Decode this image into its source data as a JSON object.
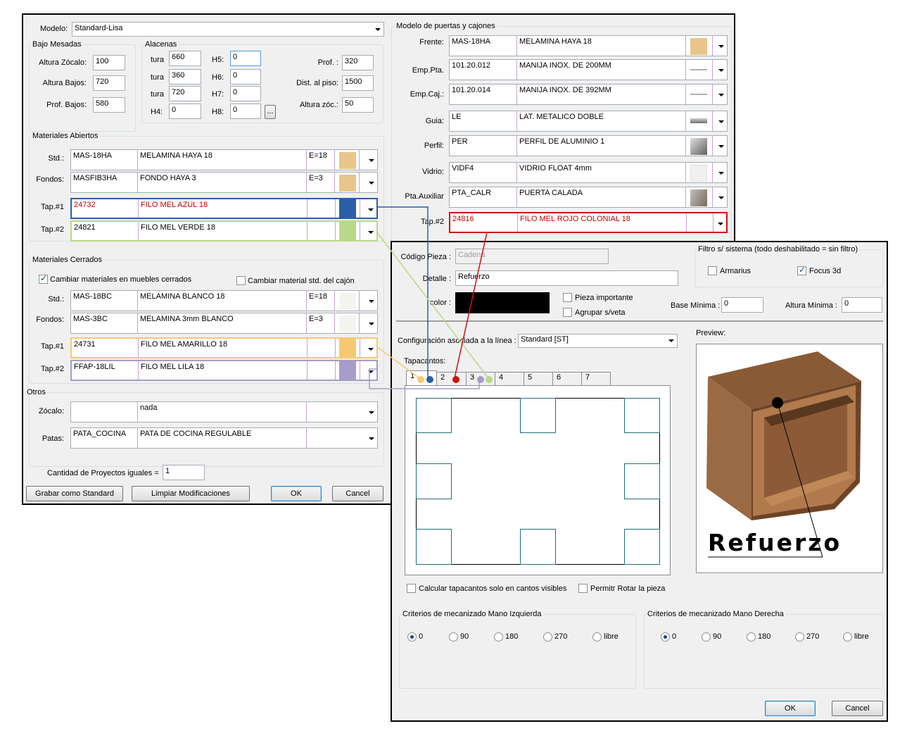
{
  "colors": {
    "blue": "#2a5fa8",
    "green": "#b8d98a",
    "red": "#d01010",
    "yellow": "#f8c870",
    "lila": "#a89cc8",
    "wood": "#e8c68a",
    "white": "#f5f5f0"
  },
  "main": {
    "modelo_label": "Modelo:",
    "modelo_value": "Standard-Lisa",
    "bajo_mesadas": {
      "title": "Bajo Mesadas",
      "altura_zocalo_label": "Altura Zócalo:",
      "altura_zocalo": "100",
      "altura_bajos_label": "Altura Bajos:",
      "altura_bajos": "720",
      "prof_bajos_label": "Prof. Bajos:",
      "prof_bajos": "580"
    },
    "alacenas": {
      "title": "Alacenas",
      "tura1_label": "tura",
      "tura1": "660",
      "tura2_label": "tura",
      "tura2": "360",
      "tura3_label": "tura",
      "tura3": "720",
      "h4_label": "H4:",
      "h4": "0",
      "h5_label": "H5:",
      "h5": "0",
      "h6_label": "H6:",
      "h6": "0",
      "h7_label": "H7:",
      "h7": "0",
      "h8_label": "H8:",
      "h8": "0",
      "more_label": "...",
      "prof_label": "Prof. :",
      "prof": "320",
      "dist_label": "Dist. al piso:",
      "dist": "1500",
      "alt_zoc_label": "Altura zóc.:",
      "alt_zoc": "50"
    },
    "abiertos": {
      "title": "Materiales Abiertos",
      "rows": [
        {
          "label": "Std.:",
          "code": "MAS-18HA",
          "desc": "MELAMINA HAYA 18",
          "e": "E=18"
        },
        {
          "label": "Fondos:",
          "code": "MASFIB3HA",
          "desc": "FONDO HAYA 3",
          "e": "E=3"
        },
        {
          "label": "Tap.#1",
          "code": "24732",
          "desc": "FILO MEL AZUL 18",
          "e": ""
        },
        {
          "label": "Tap.#2",
          "code": "24821",
          "desc": "FILO MEL VERDE 18",
          "e": ""
        }
      ]
    },
    "cerrados": {
      "title": "Materiales Cerrados",
      "chk1": "Cambiar materiales en muebles cerrados",
      "chk2": "Cambiar material std. del cajón",
      "rows": [
        {
          "label": "Std.:",
          "code": "MAS-18BC",
          "desc": "MELAMINA BLANCO 18",
          "e": "E=18"
        },
        {
          "label": "Fondos:",
          "code": "MAS-3BC",
          "desc": "MELAMINA 3mm BLANCO",
          "e": "E=3"
        },
        {
          "label": "Tap.#1",
          "code": "24731",
          "desc": "FILO MEL AMARILLO 18",
          "e": ""
        },
        {
          "label": "Tap.#2",
          "code": "FFAP-18LIL",
          "desc": "FILO MEL LILA 18",
          "e": ""
        }
      ]
    },
    "otros": {
      "title": "Otros",
      "rows": [
        {
          "label": "Zócalo:",
          "code": "",
          "desc": "nada"
        },
        {
          "label": "Patas:",
          "code": "PATA_COCINA",
          "desc": "PATA DE COCINA REGULABLE"
        }
      ]
    },
    "cantidad_label": "Cantidad de Proyectos iguales =",
    "cantidad": "1",
    "btn_grabar": "Grabar como Standard",
    "btn_limpiar": "Limpiar Modificaciones",
    "btn_ok": "OK",
    "btn_cancel": "Cancel",
    "puertas": {
      "title": "Modelo de puertas y cajones",
      "rows": [
        {
          "label": "Frente:",
          "code": "MAS-18HA",
          "desc": "MELAMINA HAYA 18"
        },
        {
          "label": "Emp.Pta.",
          "code": "101.20.012",
          "desc": "MANIJA INOX. DE 200MM"
        },
        {
          "label": "Emp.Caj.:",
          "code": "101.20.014",
          "desc": "MANIJA INOX. DE 392MM"
        },
        {
          "label": "Guia:",
          "code": "LE",
          "desc": "LAT. METALICO DOBLE"
        },
        {
          "label": "Perfil:",
          "code": "PER",
          "desc": "PERFIL DE ALUMINIO 1"
        },
        {
          "label": "Vidrio:",
          "code": "VIDF4",
          "desc": "VIDRIO FLOAT 4mm"
        },
        {
          "label": "Pta.Auxiliar",
          "code": "PTA_CALR",
          "desc": "PUERTA CALADA"
        },
        {
          "label": "Tap.#2",
          "code": "24816",
          "desc": "FILO MEL ROJO COLONIAL 18"
        }
      ]
    }
  },
  "piece": {
    "codigo_label": "Código Pieza :",
    "codigo": "Cadena",
    "detalle_label": "Detalle :",
    "detalle": "Refuerzo",
    "color_label": "color :",
    "pieza_importante": "Pieza importante",
    "agrupar": "Agrupar s/veta",
    "filtro_title": "Filtro s/ sistema (todo deshabilitado = sin filtro)",
    "armarius": "Armarius",
    "focus": "Focus 3d",
    "base_min_label": "Base Mínima :",
    "base_min": "0",
    "altura_min_label": "Altura Mínima :",
    "altura_min": "0",
    "config_label": "Configuración asociada a la línea :",
    "config_value": "Standard [ST]",
    "tapacantos_label": "Tapacantos:",
    "tabs": [
      "1",
      "2",
      "3",
      "4",
      "5",
      "6",
      "7"
    ],
    "preview_label": "Preview:",
    "preview_text": "Refuerzo",
    "calc_visible": "Calcular tapacantos solo en cantos visibles",
    "permitir_rotar": "Permitr Rotar la pieza",
    "izq_title": "Criterios de mecanizado Mano Izquierda",
    "der_title": "Criterios de mecanizado Mano Derecha",
    "radios": [
      "0",
      "90",
      "180",
      "270",
      "libre"
    ],
    "btn_ok": "OK",
    "btn_cancel": "Cancel"
  }
}
